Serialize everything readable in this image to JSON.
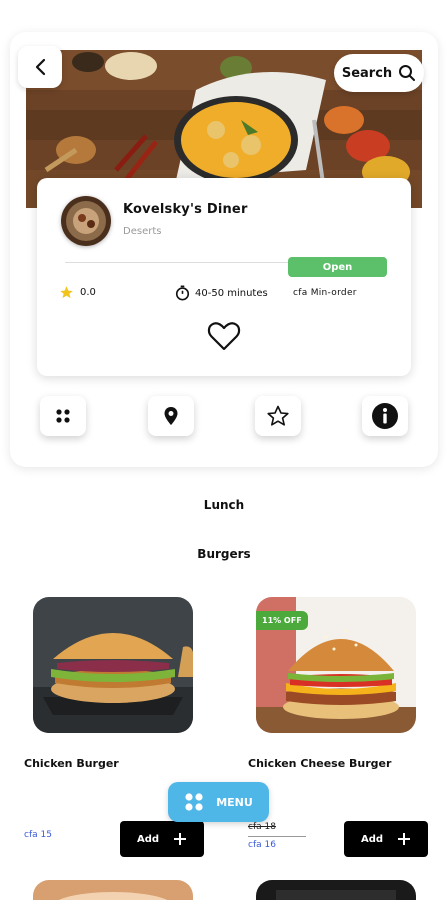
{
  "header": {
    "back_icon": "chevron-left-icon",
    "search_label": "Search",
    "search_icon": "search-icon"
  },
  "restaurant": {
    "name": "Kovelsky's Diner",
    "category": "Deserts",
    "status": "Open",
    "rating": "0.0",
    "duration": "40-50 minutes",
    "min_order": "cfa  Min-order"
  },
  "actions": [
    {
      "name": "grid-icon"
    },
    {
      "name": "location-pin-icon"
    },
    {
      "name": "star-outline-icon"
    },
    {
      "name": "info-icon"
    }
  ],
  "menu": {
    "section": "Lunch",
    "category": "Burgers",
    "items": [
      {
        "name": "Chicken Burger",
        "price": "cfa 15",
        "old_price": "",
        "discount": "",
        "add_label": "Add"
      },
      {
        "name": "Chicken Cheese Burger",
        "price": "cfa 16",
        "old_price": "cfa 18",
        "discount": "11% OFF",
        "add_label": "Add"
      }
    ]
  },
  "floating_menu": {
    "label": "MENU"
  },
  "colors": {
    "open_green": "#5cc06a",
    "discount_green": "#4caa3c",
    "menu_blue": "#4fb6e8",
    "price_blue": "#3a5bd9",
    "star_yellow": "#f2c31b"
  }
}
